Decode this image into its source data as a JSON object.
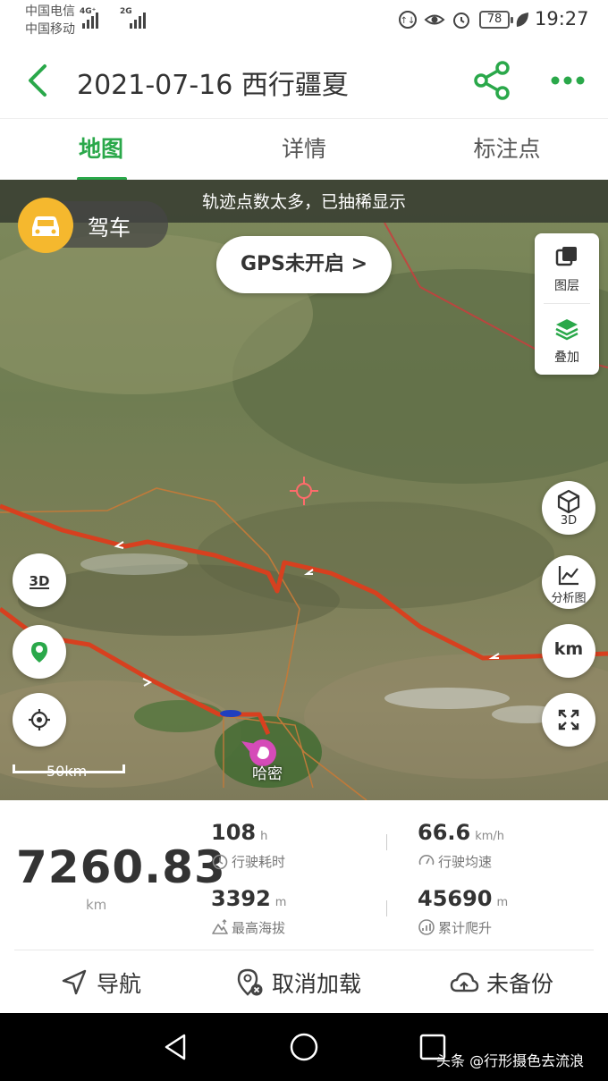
{
  "status": {
    "carrier1": "中国电信",
    "carrier2": "中国移动",
    "net1": "4G⁺",
    "net2": "2G",
    "battery": "78",
    "time": "19:27"
  },
  "header": {
    "title": "2021-07-16 西行疆夏"
  },
  "tabs": [
    {
      "label": "地图",
      "active": true
    },
    {
      "label": "详情",
      "active": false
    },
    {
      "label": "标注点",
      "active": false
    }
  ],
  "map": {
    "banner": "轨迹点数太多，已抽稀显示",
    "mode_label": "驾车",
    "gps_button": "GPS未开启 >",
    "layer_label": "图层",
    "overlay_label": "叠加",
    "btn_3d_label": "3D",
    "btn_analysis_label": "分析图",
    "btn_km_label": "km",
    "scale": "50km",
    "place": "哈密",
    "route_color": "#d7401f",
    "road_color": "#c07a3a"
  },
  "stats": {
    "total": "7260.83",
    "total_unit": "km",
    "duration": {
      "value": "108",
      "unit": "h",
      "label": "行驶耗时"
    },
    "avg_speed": {
      "value": "66.6",
      "unit": "km/h",
      "label": "行驶均速"
    },
    "max_altitude": {
      "value": "3392",
      "unit": "m",
      "label": "最高海拔"
    },
    "total_climb": {
      "value": "45690",
      "unit": "m",
      "label": "累计爬升"
    }
  },
  "actions": {
    "navigate": "导航",
    "unload": "取消加载",
    "backup": "未备份"
  },
  "footer": {
    "watermark": "头条 @行形摄色去流浪"
  },
  "accent_color": "#2aa84a"
}
